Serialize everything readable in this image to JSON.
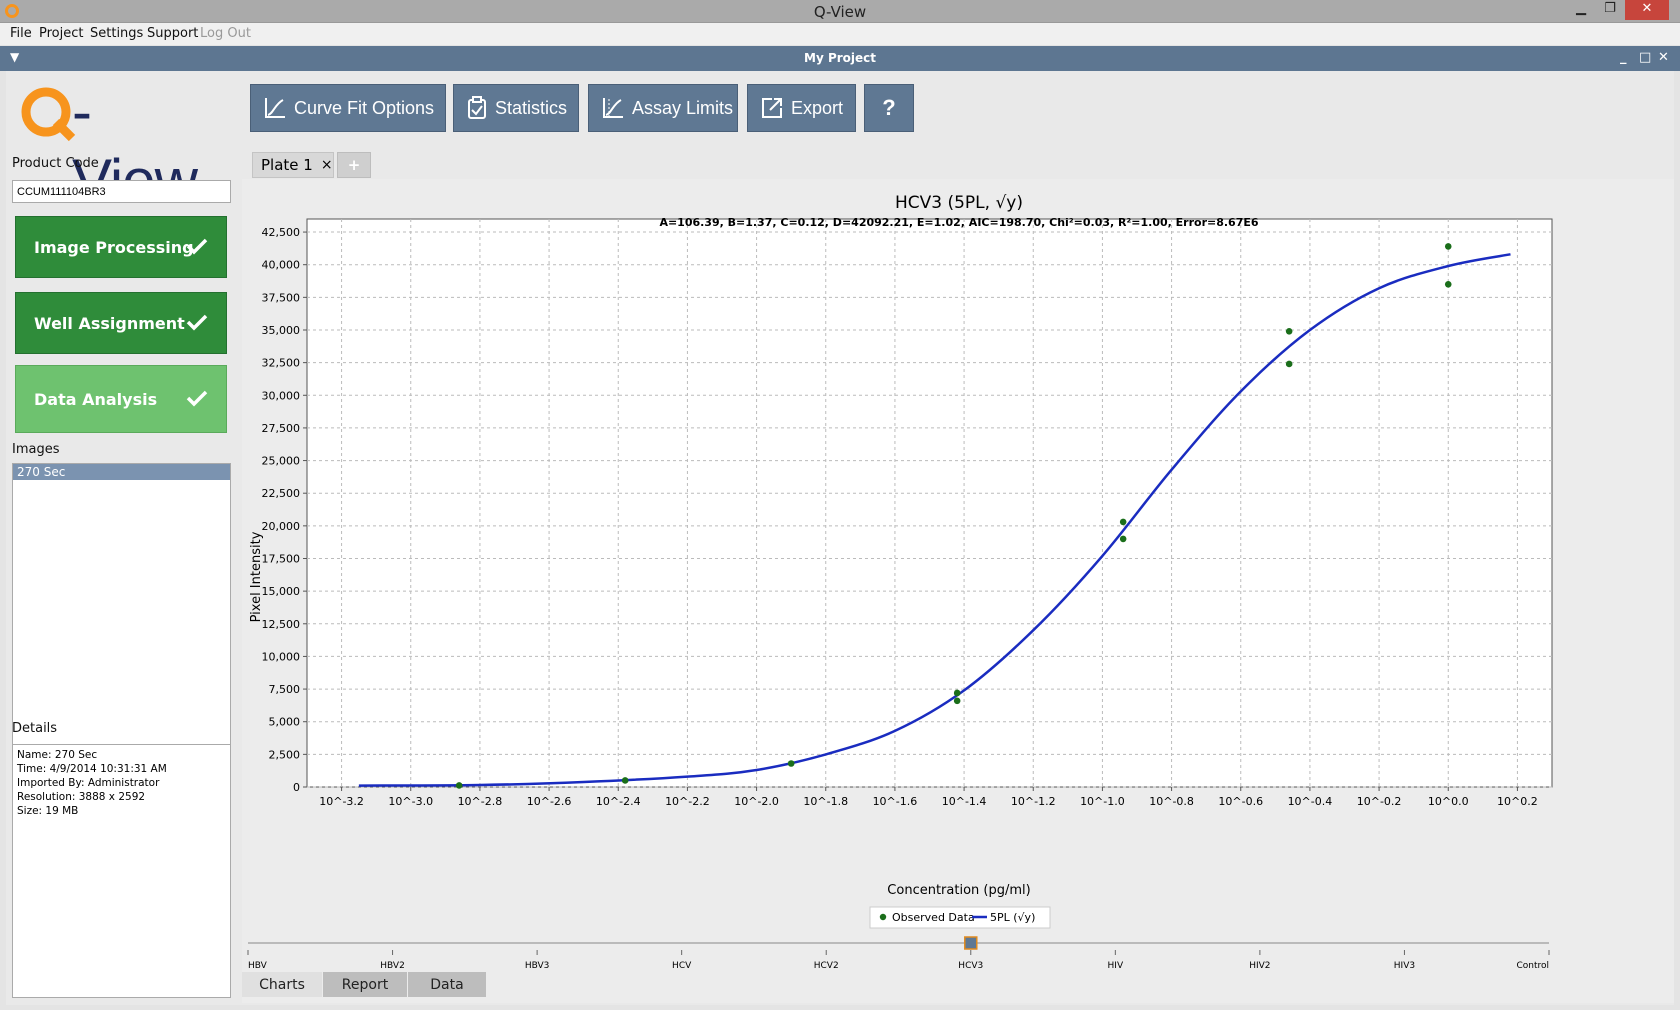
{
  "window": {
    "title": "Q-View",
    "restore_glyph": "❐",
    "close_glyph": "✕"
  },
  "menu": [
    {
      "label": "File",
      "enabled": true
    },
    {
      "label": "Project",
      "enabled": true
    },
    {
      "label": "Settings",
      "enabled": true
    },
    {
      "label": "Support",
      "enabled": true
    },
    {
      "label": "Log Out",
      "enabled": false
    }
  ],
  "project_bar": {
    "title": "My Project",
    "minimize": "_",
    "maximize": "□",
    "close": "✕"
  },
  "logo": {
    "text": "-View",
    "q_color": "#f7941d"
  },
  "toolbar": {
    "curve_fit": "Curve Fit Options",
    "statistics": "Statistics",
    "assay_limits": "Assay Limits",
    "export": "Export",
    "help": "?"
  },
  "sidebar": {
    "product_code_label": "Product Code",
    "product_code_value": "CCUM111104BR3",
    "steps": [
      {
        "label": "Image Processing",
        "done": true,
        "color": "#2f8c3a"
      },
      {
        "label": "Well Assignment",
        "done": true,
        "color": "#2f8c3a"
      },
      {
        "label": "Data Analysis",
        "done": true,
        "color": "#6ec26f"
      }
    ],
    "images_label": "Images",
    "images": [
      "270 Sec"
    ],
    "details_label": "Details",
    "details": [
      "Name: 270 Sec",
      "Time: 4/9/2014 10:31:31 AM",
      "Imported By: Administrator",
      "Resolution: 3888 x 2592",
      "Size: 19 MB"
    ]
  },
  "plate_tabs": [
    {
      "label": "Plate 1",
      "close": "×"
    }
  ],
  "add_tab": "+",
  "chart_data": {
    "type": "scatter",
    "title": "HCV3 (5PL, √y)",
    "subtitle": "A=106.39, B=1.37, C=0.12, D=42092.21, E=1.02, AIC=198.70, Chi²=0.03, R²=1.00, Error=8.67E6",
    "xlabel": "Concentration (pg/ml)",
    "ylabel": "Pixel Intensity",
    "x_scale": "log10",
    "xlim": [
      -3.3,
      0.3
    ],
    "ylim": [
      0,
      43500
    ],
    "grid": true,
    "x_ticks": [
      "10^-3.2",
      "10^-3.0",
      "10^-2.8",
      "10^-2.6",
      "10^-2.4",
      "10^-2.2",
      "10^-2.0",
      "10^-1.8",
      "10^-1.6",
      "10^-1.4",
      "10^-1.2",
      "10^-1.0",
      "10^-0.8",
      "10^-0.6",
      "10^-0.4",
      "10^-0.2",
      "10^0.0",
      "10^0.2"
    ],
    "y_ticks": [
      "0",
      "2,500",
      "5,000",
      "7,500",
      "10,000",
      "12,500",
      "15,000",
      "17,500",
      "20,000",
      "22,500",
      "25,000",
      "27,500",
      "30,000",
      "32,500",
      "35,000",
      "37,500",
      "40,000",
      "42,500"
    ],
    "legend": {
      "position": "bottom-center",
      "entries": [
        "Observed Data",
        "5PL (√y)"
      ]
    },
    "series": [
      {
        "name": "Observed Data",
        "color": "#1a6e1a",
        "points": [
          {
            "x": -2.86,
            "y": 120
          },
          {
            "x": -2.38,
            "y": 500
          },
          {
            "x": -1.9,
            "y": 1800
          },
          {
            "x": -1.42,
            "y": 7200
          },
          {
            "x": -1.42,
            "y": 6600
          },
          {
            "x": -0.94,
            "y": 20300
          },
          {
            "x": -0.94,
            "y": 19000
          },
          {
            "x": -0.46,
            "y": 34900
          },
          {
            "x": -0.46,
            "y": 32400
          },
          {
            "x": 0.0,
            "y": 41400
          },
          {
            "x": 0.0,
            "y": 38500
          }
        ]
      },
      {
        "name": "5PL (√y)",
        "color": "#1a2cc0",
        "curve": {
          "model": "5PL",
          "x_range": [
            -3.15,
            0.18
          ],
          "knots": [
            {
              "x": -3.15,
              "y": 107
            },
            {
              "x": -2.8,
              "y": 150
            },
            {
              "x": -2.5,
              "y": 380
            },
            {
              "x": -2.2,
              "y": 800
            },
            {
              "x": -2.0,
              "y": 1300
            },
            {
              "x": -1.8,
              "y": 2500
            },
            {
              "x": -1.6,
              "y": 4300
            },
            {
              "x": -1.4,
              "y": 7400
            },
            {
              "x": -1.2,
              "y": 12000
            },
            {
              "x": -1.0,
              "y": 17700
            },
            {
              "x": -0.8,
              "y": 24300
            },
            {
              "x": -0.6,
              "y": 30300
            },
            {
              "x": -0.4,
              "y": 35000
            },
            {
              "x": -0.2,
              "y": 38200
            },
            {
              "x": 0.0,
              "y": 39900
            },
            {
              "x": 0.18,
              "y": 40800
            }
          ]
        }
      }
    ]
  },
  "analyte_slider": {
    "labels": [
      "HBV",
      "HBV2",
      "HBV3",
      "HCV",
      "HCV2",
      "HCV3",
      "HIV",
      "HIV2",
      "HIV3",
      "Control"
    ],
    "selected": "HCV3"
  },
  "bottom_tabs": [
    {
      "label": "Charts",
      "active": true
    },
    {
      "label": "Report",
      "active": false
    },
    {
      "label": "Data",
      "active": false
    }
  ]
}
